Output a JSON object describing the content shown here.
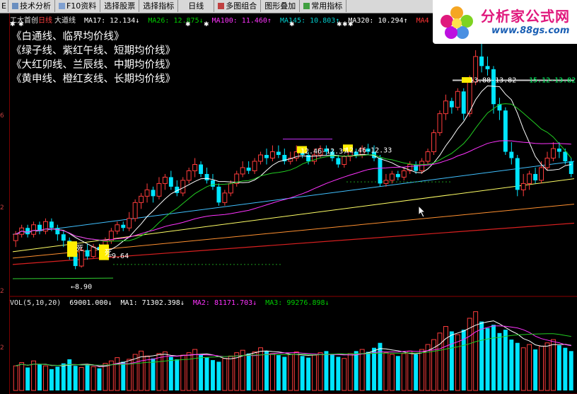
{
  "toolbar": [
    {
      "label": "技术分析",
      "icon": "chart-icon"
    },
    {
      "label": "F10资料",
      "icon": "document-icon"
    },
    {
      "label": "选择股票",
      "icon": ""
    },
    {
      "label": "选择指标",
      "icon": ""
    },
    {
      "label": "日线",
      "icon": ""
    },
    {
      "label": "多图组合",
      "icon": "grid-icon"
    },
    {
      "label": "图形叠加",
      "icon": ""
    },
    {
      "label": "常用指标",
      "icon": "list-icon"
    }
  ],
  "price_legend": {
    "name": "工大首创",
    "code": "日线",
    "kind": "大道线",
    "items": [
      {
        "text": "MA17: 12.134↓",
        "color": "#ffffff"
      },
      {
        "text": "MA26: 12.875↓",
        "color": "#00cc00"
      },
      {
        "text": "MA100: 11.460↑",
        "color": "#ff33ff"
      },
      {
        "text": "MA145: 10.803↑",
        "color": "#00cccc"
      },
      {
        "text": "MA320: 10.294↑",
        "color": "#ffffff"
      },
      {
        "text": "MA4",
        "color": "#ff3333"
      }
    ]
  },
  "notes": [
    "《白通线、临界均价线》",
    "《绿子线、紫红午线、短期均价线》",
    "《大红卯线、兰辰线、中期均价线》",
    "《黄申线、橙红亥线、长期均价线》"
  ],
  "volume_legend": {
    "title": "VOL(5,10,20)",
    "items": [
      {
        "text": "69001.000↓",
        "color": "#ffffff"
      },
      {
        "text": "MA1: 71302.398↓",
        "color": "#ffffff"
      },
      {
        "text": "MA2: 81171.703↓",
        "color": "#ff33ff"
      },
      {
        "text": "MA3: 99276.898↓",
        "color": "#00cc00"
      }
    ]
  },
  "logo": {
    "title": "分析家公式网",
    "url": "www.88gs.com"
  },
  "y_ticks": [
    "6",
    "2",
    "2",
    "2"
  ],
  "chart_data": {
    "type": "candlestick",
    "candles": [
      [
        9.8,
        10.0,
        9.6,
        10.1
      ],
      [
        10.0,
        10.2,
        9.9,
        10.3
      ],
      [
        10.2,
        10.0,
        9.9,
        10.3
      ],
      [
        10.0,
        10.3,
        9.9,
        10.4
      ],
      [
        10.3,
        10.1,
        10.0,
        10.4
      ],
      [
        10.1,
        10.4,
        10.0,
        10.5
      ],
      [
        10.4,
        10.2,
        10.1,
        10.5
      ],
      [
        10.2,
        10.0,
        9.8,
        10.3
      ],
      [
        10.0,
        9.8,
        9.6,
        10.1
      ],
      [
        9.8,
        9.4,
        9.2,
        9.9
      ],
      [
        9.4,
        9.0,
        8.9,
        9.5
      ],
      [
        9.0,
        9.5,
        8.95,
        9.6
      ],
      [
        9.5,
        9.3,
        9.2,
        9.7
      ],
      [
        9.3,
        9.6,
        9.25,
        9.7
      ],
      [
        9.6,
        9.5,
        9.4,
        9.7
      ],
      [
        9.5,
        9.8,
        9.4,
        9.9
      ],
      [
        9.8,
        10.1,
        9.7,
        10.2
      ],
      [
        10.1,
        10.3,
        10.0,
        10.4
      ],
      [
        10.3,
        10.2,
        10.1,
        10.4
      ],
      [
        10.2,
        10.5,
        10.1,
        10.7
      ],
      [
        10.5,
        11.0,
        10.4,
        11.1
      ],
      [
        11.0,
        11.2,
        10.8,
        11.3
      ],
      [
        11.2,
        11.4,
        11.0,
        11.6
      ],
      [
        11.4,
        11.2,
        11.0,
        11.5
      ],
      [
        11.2,
        11.6,
        11.1,
        11.8
      ],
      [
        11.6,
        11.8,
        11.4,
        11.9
      ],
      [
        11.8,
        11.5,
        11.4,
        12.0
      ],
      [
        11.5,
        11.3,
        11.2,
        11.7
      ],
      [
        11.3,
        11.7,
        11.2,
        11.8
      ],
      [
        11.7,
        12.0,
        11.6,
        12.1
      ],
      [
        12.0,
        12.2,
        11.8,
        12.4
      ],
      [
        12.2,
        11.9,
        11.8,
        12.3
      ],
      [
        11.9,
        11.7,
        11.6,
        12.1
      ],
      [
        11.7,
        11.5,
        11.4,
        11.9
      ],
      [
        11.5,
        11.0,
        10.9,
        11.6
      ],
      [
        11.0,
        11.3,
        10.9,
        11.4
      ],
      [
        11.3,
        11.6,
        11.2,
        11.7
      ],
      [
        11.6,
        11.9,
        11.5,
        12.0
      ],
      [
        11.9,
        12.1,
        11.8,
        12.3
      ],
      [
        12.1,
        12.0,
        11.9,
        12.3
      ],
      [
        12.0,
        12.3,
        11.9,
        12.4
      ],
      [
        12.3,
        12.5,
        12.2,
        12.6
      ],
      [
        12.5,
        12.4,
        12.2,
        12.7
      ],
      [
        12.4,
        12.6,
        12.3,
        12.8
      ],
      [
        12.6,
        12.5,
        12.4,
        12.8
      ],
      [
        12.5,
        12.3,
        12.2,
        12.7
      ],
      [
        12.3,
        12.4,
        12.2,
        12.6
      ],
      [
        12.4,
        12.6,
        12.3,
        12.8
      ],
      [
        12.6,
        12.5,
        12.4,
        12.7
      ],
      [
        12.5,
        12.3,
        12.2,
        12.6
      ],
      [
        12.3,
        12.5,
        12.2,
        12.7
      ],
      [
        12.5,
        12.7,
        12.4,
        12.8
      ],
      [
        12.7,
        12.6,
        12.5,
        12.8
      ],
      [
        12.6,
        12.4,
        12.3,
        12.7
      ],
      [
        12.4,
        12.2,
        12.1,
        12.5
      ],
      [
        12.2,
        12.45,
        12.1,
        12.5
      ],
      [
        12.45,
        12.6,
        12.3,
        12.7
      ],
      [
        12.6,
        12.5,
        12.4,
        12.7
      ],
      [
        12.5,
        12.7,
        12.4,
        12.8
      ],
      [
        12.7,
        12.6,
        12.5,
        12.85
      ],
      [
        12.6,
        12.4,
        12.3,
        12.8
      ],
      [
        12.4,
        11.6,
        11.5,
        12.5
      ],
      [
        11.6,
        11.7,
        11.5,
        11.9
      ],
      [
        11.7,
        11.9,
        11.6,
        12.0
      ],
      [
        11.9,
        11.8,
        11.7,
        12.0
      ],
      [
        11.8,
        12.0,
        11.7,
        12.1
      ],
      [
        12.0,
        12.2,
        11.9,
        12.3
      ],
      [
        12.2,
        12.0,
        11.9,
        12.3
      ],
      [
        12.0,
        12.3,
        11.9,
        12.4
      ],
      [
        12.3,
        12.6,
        12.2,
        12.7
      ],
      [
        12.6,
        13.2,
        12.5,
        13.3
      ],
      [
        13.2,
        13.8,
        13.1,
        13.9
      ],
      [
        13.8,
        14.2,
        13.6,
        14.4
      ],
      [
        14.2,
        14.0,
        13.8,
        14.3
      ],
      [
        14.0,
        14.5,
        13.9,
        14.6
      ],
      [
        14.5,
        13.8,
        13.6,
        14.6
      ],
      [
        13.8,
        14.8,
        13.7,
        15.0
      ],
      [
        14.8,
        15.6,
        14.7,
        15.8
      ],
      [
        15.6,
        15.3,
        15.1,
        16.3
      ],
      [
        15.3,
        15.2,
        15.0,
        15.6
      ],
      [
        15.2,
        14.1,
        13.8,
        15.3
      ],
      [
        14.1,
        13.9,
        13.6,
        14.3
      ],
      [
        13.9,
        12.6,
        12.5,
        14.0
      ],
      [
        12.6,
        12.4,
        12.2,
        12.9
      ],
      [
        12.4,
        11.4,
        11.2,
        12.5
      ],
      [
        11.4,
        11.6,
        11.2,
        11.9
      ],
      [
        11.6,
        11.9,
        11.4,
        12.0
      ],
      [
        11.9,
        11.7,
        11.6,
        12.1
      ],
      [
        11.7,
        12.1,
        11.6,
        12.3
      ],
      [
        12.1,
        12.4,
        12.0,
        12.6
      ],
      [
        12.4,
        12.7,
        12.3,
        12.9
      ],
      [
        12.7,
        12.6,
        12.4,
        12.9
      ],
      [
        12.6,
        12.3,
        12.2,
        12.7
      ],
      [
        12.3,
        11.9,
        11.8,
        12.4
      ]
    ],
    "volume": [
      30,
      34,
      28,
      36,
      32,
      30,
      26,
      29,
      33,
      38,
      30,
      28,
      31,
      29,
      27,
      33,
      36,
      40,
      35,
      38,
      44,
      48,
      42,
      39,
      45,
      47,
      41,
      38,
      43,
      46,
      50,
      44,
      40,
      37,
      35,
      39,
      42,
      46,
      49,
      45,
      47,
      52,
      48,
      45,
      43,
      41,
      44,
      47,
      42,
      40,
      43,
      46,
      48,
      44,
      41,
      39,
      45,
      48,
      50,
      47,
      52,
      58,
      46,
      44,
      42,
      45,
      48,
      44,
      50,
      56,
      62,
      70,
      78,
      72,
      68,
      74,
      88,
      96,
      84,
      76,
      80,
      70,
      74,
      62,
      58,
      52,
      56,
      50,
      54,
      58,
      62,
      55,
      52,
      48
    ],
    "annotations": [
      "9.64",
      "8.90",
      "12.46-12.37",
      "12.46-12.33",
      "13.88-13.82",
      "15.12-13.82",
      "死",
      "死"
    ]
  }
}
